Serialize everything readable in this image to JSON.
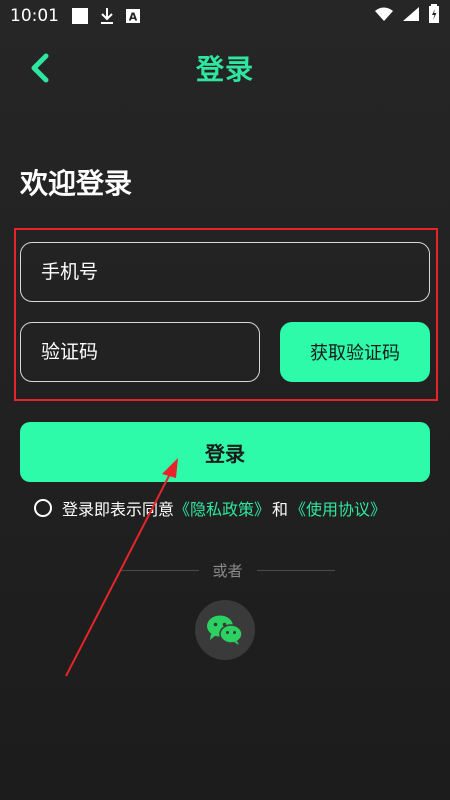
{
  "status_bar": {
    "time": "10:01",
    "icons": [
      "square-icon",
      "download-icon",
      "a-icon",
      "wifi-icon",
      "signal-icon",
      "battery-icon"
    ]
  },
  "header": {
    "title": "登录",
    "back_icon": "chevron-left-icon"
  },
  "welcome": "欢迎登录",
  "form": {
    "phone_placeholder": "手机号",
    "code_placeholder": "验证码",
    "get_code_label": "获取验证码"
  },
  "login_button": "登录",
  "agreement": {
    "prefix": "登录即表示同意",
    "privacy_link": "《隐私政策》",
    "and": "和",
    "terms_link": "《使用协议》"
  },
  "divider_text": "或者",
  "social": {
    "wechat_icon": "wechat-icon"
  },
  "colors": {
    "accent": "#2dfba9",
    "title_green": "#2fe6a0",
    "highlight_red": "#e8242a",
    "background": "#222222"
  }
}
